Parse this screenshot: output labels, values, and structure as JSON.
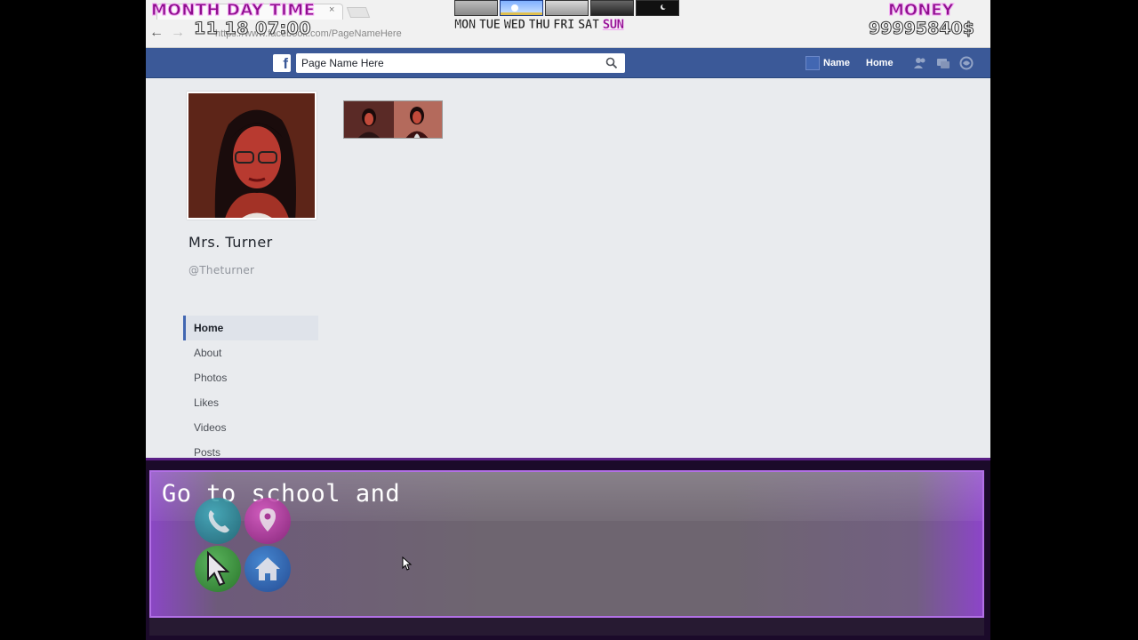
{
  "browser": {
    "tab_close": "×",
    "url": "https://www.facebook.com/PageNameHere",
    "back": "←",
    "forward": "→"
  },
  "fb_header": {
    "logo": "f",
    "search_placeholder": "Page Name Here",
    "name_link": "Name",
    "home_link": "Home",
    "color": "#3b5998"
  },
  "profile": {
    "name": "Mrs. Turner",
    "handle": "@Theturner"
  },
  "side_nav": {
    "items": [
      {
        "label": "Home",
        "active": true
      },
      {
        "label": "About"
      },
      {
        "label": "Photos"
      },
      {
        "label": "Likes"
      },
      {
        "label": "Videos"
      },
      {
        "label": "Posts"
      }
    ]
  },
  "hud": {
    "month_day_time_label": "MONTH DAY TIME",
    "datetime": "11 18 07:00",
    "money_label": "MONEY",
    "money": "99995840$",
    "weekdays": [
      "MON",
      "TUE",
      "WED",
      "THU",
      "FRI",
      "SAT",
      "SUN"
    ],
    "current_day": "SUN",
    "accent_color": "#8e0e8e"
  },
  "dialog": {
    "text": "Go to school and"
  },
  "quick_buttons": [
    {
      "icon": "phone-icon"
    },
    {
      "icon": "map-pin-icon"
    },
    {
      "icon": "cursor-icon"
    },
    {
      "icon": "home-icon"
    }
  ]
}
